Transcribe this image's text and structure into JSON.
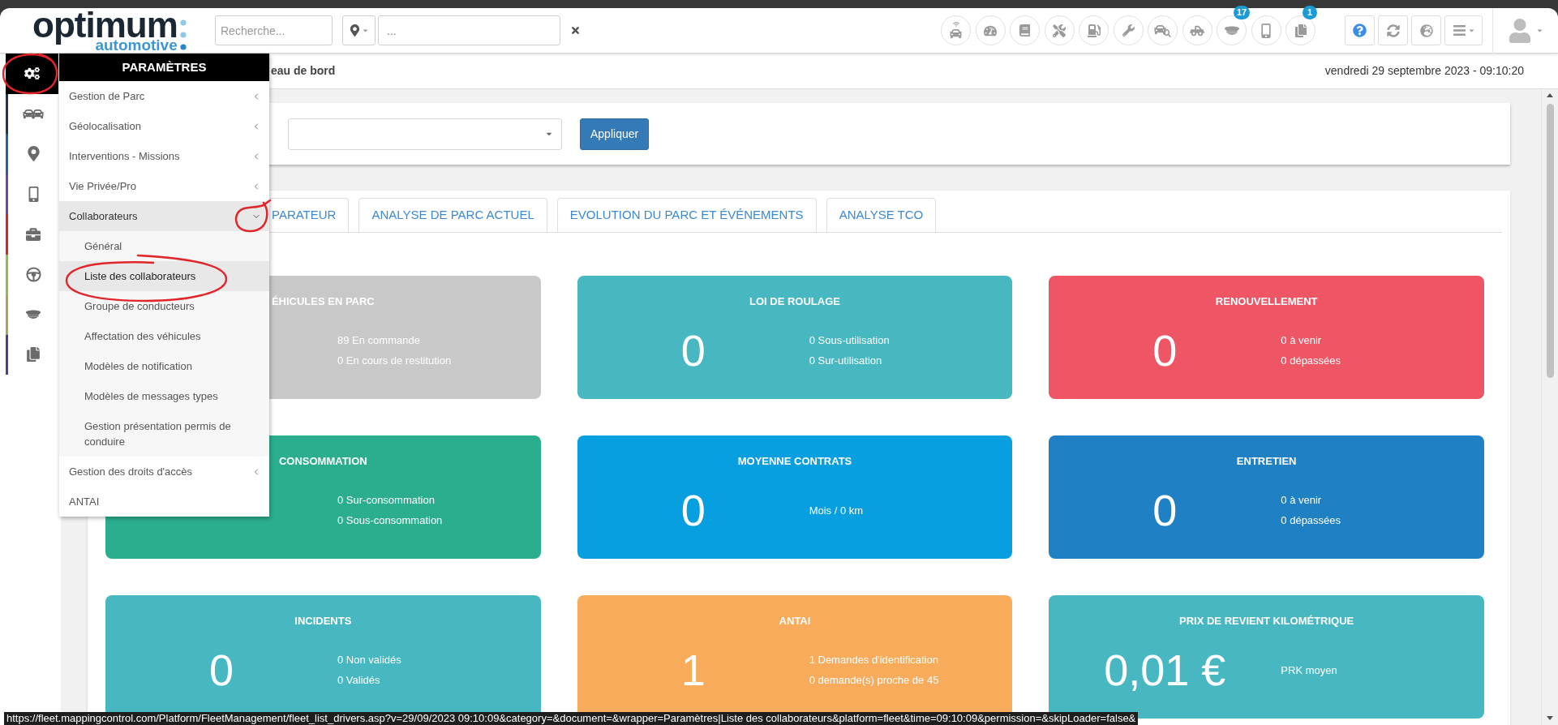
{
  "header": {
    "logo": {
      "wordmark": "optimum",
      "tagline": "automotive"
    },
    "search": {
      "placeholder": "Recherche..."
    },
    "location": {
      "placeholder": "..."
    },
    "shortcuts": [
      {
        "kind": "telematics"
      },
      {
        "kind": "gauge"
      },
      {
        "kind": "logbook"
      },
      {
        "kind": "tools"
      },
      {
        "kind": "fuel"
      },
      {
        "kind": "wrench"
      },
      {
        "kind": "inspection"
      },
      {
        "kind": "towing"
      },
      {
        "kind": "driver",
        "badge": "17"
      },
      {
        "kind": "phone"
      },
      {
        "kind": "documents",
        "badge": "1"
      }
    ],
    "tools": [
      {
        "kind": "help"
      },
      {
        "kind": "refresh"
      },
      {
        "kind": "globe"
      },
      {
        "kind": "menu"
      }
    ]
  },
  "breadcrumb": "eau de bord",
  "date": "vendredi 29 septembre 2023 - 09:10:20",
  "sidebar": [
    {
      "kind": "settings",
      "selected": true
    },
    {
      "kind": "vehicles",
      "selected": false,
      "color": "#1d3557"
    },
    {
      "kind": "location",
      "selected": false,
      "color": "#2a5f9e"
    },
    {
      "kind": "phone",
      "selected": false,
      "color": "#6c4a9b"
    },
    {
      "kind": "briefcase",
      "selected": false,
      "color": "#d7262b"
    },
    {
      "kind": "steering",
      "selected": false,
      "color": "#8cc04a"
    },
    {
      "kind": "driver",
      "selected": false,
      "color": "#a8a55a"
    },
    {
      "kind": "documents",
      "selected": false,
      "color": "#4b3f8e"
    }
  ],
  "settings_menu": {
    "title": "PARAMÈTRES",
    "items": [
      {
        "label": "Gestion de Parc",
        "kind": "submenu",
        "expanded": false
      },
      {
        "label": "Géolocalisation",
        "kind": "submenu",
        "expanded": false
      },
      {
        "label": "Interventions - Missions",
        "kind": "submenu",
        "expanded": false
      },
      {
        "label": "Vie Privée/Pro",
        "kind": "submenu",
        "expanded": false
      },
      {
        "label": "Collaborateurs",
        "kind": "submenu",
        "expanded": true,
        "children": [
          {
            "label": "Général",
            "selected": false
          },
          {
            "label": "Liste des collaborateurs",
            "selected": true
          },
          {
            "label": "Groupe de conducteurs",
            "selected": false
          },
          {
            "label": "Affectation des véhicules",
            "selected": false
          },
          {
            "label": "Modèles de notification",
            "selected": false
          },
          {
            "label": "Modèles de messages types",
            "selected": false
          },
          {
            "label": "Gestion présentation permis de conduire",
            "selected": false
          }
        ]
      },
      {
        "label": "Gestion des droits d'accès",
        "kind": "submenu",
        "expanded": false
      },
      {
        "label": "ANTAI",
        "kind": "link"
      }
    ]
  },
  "filter": {
    "apply_button": "Appliquer"
  },
  "tabs": [
    {
      "label": "PARATEUR",
      "selected": false
    },
    {
      "label": "ANALYSE DE PARC ACTUEL",
      "selected": false
    },
    {
      "label": "EVOLUTION DU PARC ET ÉVÉNEMENTS",
      "selected": false
    },
    {
      "label": "ANALYSE TCO",
      "selected": false
    }
  ],
  "cards": [
    {
      "title": "ÉHICULES EN PARC",
      "color": "#c8c8c8",
      "lines": [
        "89 En commande",
        "0 En cours de restitution"
      ]
    },
    {
      "title": "LOI DE ROULAGE",
      "value": "0",
      "color": "#47b8c1",
      "lines": [
        "0 Sous-utilisation",
        "0 Sur-utilisation"
      ]
    },
    {
      "title": "RENOUVELLEMENT",
      "value": "0",
      "color": "#ee5565",
      "lines": [
        "0 à venir",
        "0 dépassées"
      ]
    },
    {
      "title": "CONSOMMATION",
      "color": "#2aae8e",
      "lines": [
        "0 Sur-consommation",
        "0 Sous-consommation"
      ]
    },
    {
      "title": "MOYENNE CONTRATS",
      "value": "0",
      "color": "#089fe0",
      "lines": [
        "Mois / 0 km"
      ]
    },
    {
      "title": "ENTRETIEN",
      "value": "0",
      "color": "#1f80c3",
      "lines": [
        "0 à venir",
        "0 dépassées"
      ]
    },
    {
      "title": "INCIDENTS",
      "value": "0",
      "color": "#47b8c1",
      "lines": [
        "0 Non validés",
        "0 Validés"
      ]
    },
    {
      "title": "ANTAI",
      "value": "1",
      "color": "#f8ab5a",
      "lines": [
        "1 Demandes d'identification",
        "0 demande(s) proche de 45"
      ]
    },
    {
      "title": "PRIX DE REVIENT KILOMÉTRIQUE",
      "value": "0,01 €",
      "color": "#47b8c1",
      "lines": [
        "PRK moyen"
      ]
    }
  ],
  "status_url": "https://fleet.mappingcontrol.com/Platform/FleetManagement/fleet_list_drivers.asp?v=29/09/2023 09:10:09&category=&document=&wrapper=Paramètres|Liste des collaborateurs&platform=fleet&time=09:10:09&permission=&skipLoader=false&"
}
